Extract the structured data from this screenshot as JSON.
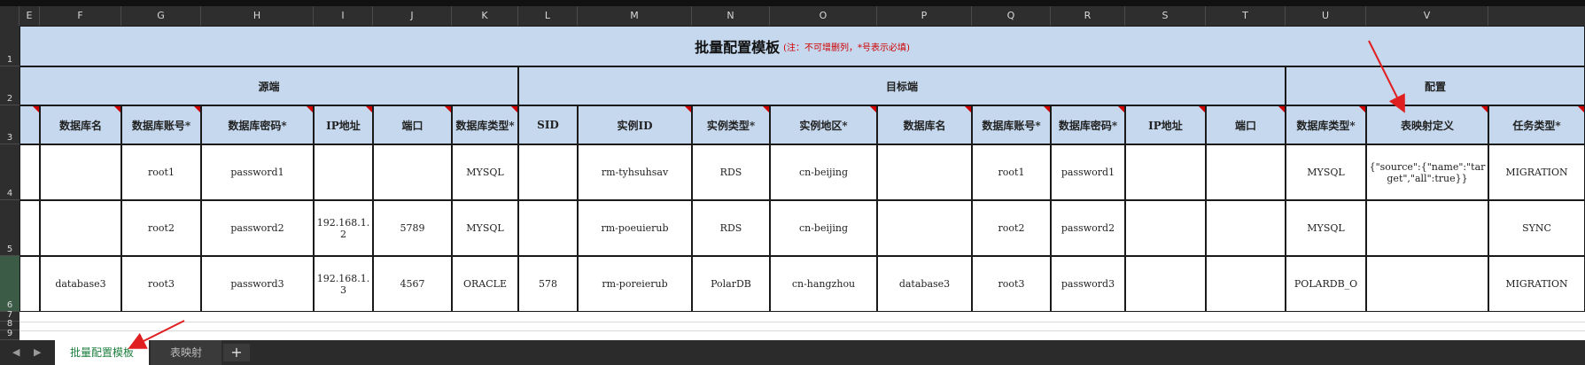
{
  "columns": [
    "",
    "E",
    "F",
    "G",
    "H",
    "I",
    "J",
    "K",
    "L",
    "M",
    "N",
    "O",
    "P",
    "Q",
    "R",
    "S",
    "T",
    "U",
    "V"
  ],
  "rows": [
    "1",
    "2",
    "3",
    "4",
    "5",
    "6",
    "7",
    "8",
    "9"
  ],
  "title": "批量配置模板",
  "title_note": "(注：不可增删列，*号表示必填)",
  "groups": {
    "source": "源端",
    "target": "目标端",
    "config": "配置"
  },
  "headers": [
    "数据库名",
    "数据库账号*",
    "数据库密码*",
    "IP地址",
    "端口",
    "数据库类型*",
    "SID",
    "实例ID",
    "实例类型*",
    "实例地区*",
    "数据库名",
    "数据库账号*",
    "数据库密码*",
    "IP地址",
    "端口",
    "数据库类型*",
    "表映射定义",
    "任务类型*"
  ],
  "data_rows": [
    [
      "",
      "root1",
      "password1",
      "",
      "",
      "MYSQL",
      "",
      "rm-tyhsuhsav",
      "RDS",
      "cn-beijing",
      "",
      "root1",
      "password1",
      "",
      "",
      "MYSQL",
      "{\"source\":{\"name\":\"target\",\"all\":true}}",
      "MIGRATION"
    ],
    [
      "",
      "root2",
      "password2",
      "192.168.1.2",
      "5789",
      "MYSQL",
      "",
      "rm-poeuierub",
      "RDS",
      "cn-beijing",
      "",
      "root2",
      "password2",
      "",
      "",
      "MYSQL",
      "",
      "SYNC"
    ],
    [
      "database3",
      "root3",
      "password3",
      "192.168.1.3",
      "4567",
      "ORACLE",
      "578",
      "rm-poreierub",
      "PolarDB",
      "cn-hangzhou",
      "database3",
      "root3",
      "password3",
      "",
      "",
      "POLARDB_O",
      "",
      "MIGRATION"
    ]
  ],
  "sheet_tabs": [
    {
      "label": "批量配置模板",
      "active": true
    },
    {
      "label": "表映射",
      "active": false
    }
  ],
  "add_tab": "+",
  "nav": {
    "prev": "◀",
    "next": "▶"
  },
  "colors": {
    "band": "#c5d8ee",
    "note_red": "#d00000",
    "active_tab_text": "#1e7f3e",
    "arrow": "#e02020"
  }
}
